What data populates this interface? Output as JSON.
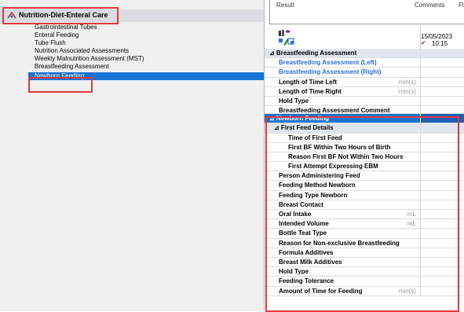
{
  "left_panel": {
    "category_title": "Nutrition-Diet-Enteral Care",
    "items": [
      {
        "label": "Gastrointestinal Tubes"
      },
      {
        "label": "Enteral Feeding"
      },
      {
        "label": "Tube Flush"
      },
      {
        "label": "Nutrition Associated Assessments"
      },
      {
        "label": "Weekly Malnutrition Assessment (MST)"
      },
      {
        "label": "Breastfeeding Assessment"
      },
      {
        "label": "Newborn Feeding"
      }
    ],
    "selected_item": "Newborn Feeding"
  },
  "top_box": {
    "left_text": "Result",
    "right_text": "Comments",
    "far_right_text": "Fl"
  },
  "grid": {
    "date": "15/05/2023",
    "time": "10:15",
    "rows": [
      {
        "label": "Breastfeeding Assessment",
        "kind": "section",
        "prefix": "⊿"
      },
      {
        "label": "Breastfeeding Assessment (Left)",
        "kind": "link"
      },
      {
        "label": "Breastfeeding Assessment (Right)",
        "kind": "link"
      },
      {
        "label": "Length of Time Left",
        "unit": "min(s)"
      },
      {
        "label": "Length of Time Right",
        "unit": "min(s)"
      },
      {
        "label": "Hold Type"
      },
      {
        "label": "Breastfeeding Assessment Comment",
        "kind": "trunc"
      },
      {
        "label": "Newborn Feeding",
        "kind": "active",
        "prefix": "⊿"
      },
      {
        "label": "First Feed Details",
        "kind": "subsection",
        "prefix": "⊿"
      },
      {
        "label": "Time of First Feed",
        "indent": 2
      },
      {
        "label": "First BF Within Two Hours of Birth",
        "indent": 2
      },
      {
        "label": "Reason First BF Not Within Two Hours",
        "indent": 2
      },
      {
        "label": "First Attempt Expressing EBM",
        "indent": 2
      },
      {
        "label": "Person Administering Feed"
      },
      {
        "label": "Feeding Method Newborn"
      },
      {
        "label": "Feeding Type Newborn"
      },
      {
        "label": "Breast Contact"
      },
      {
        "label": "Oral Intake",
        "unit": "mL"
      },
      {
        "label": "Intended Volume",
        "unit": "mL"
      },
      {
        "label": "Bottle Teat Type"
      },
      {
        "label": "Reason for Non-exclusive Breastfeeding"
      },
      {
        "label": "Formula Additives"
      },
      {
        "label": "Breast Milk Additives"
      },
      {
        "label": "Hold Type"
      },
      {
        "label": "Feeding Tolerance"
      },
      {
        "label": "Amount of Time for Feeding",
        "unit": "min(s)"
      }
    ]
  },
  "colors": {
    "highlight_box": "#e0393e",
    "selection": "#1874d2",
    "link_text": "#2c6fd6",
    "section_bg": "#dfe6f0"
  }
}
